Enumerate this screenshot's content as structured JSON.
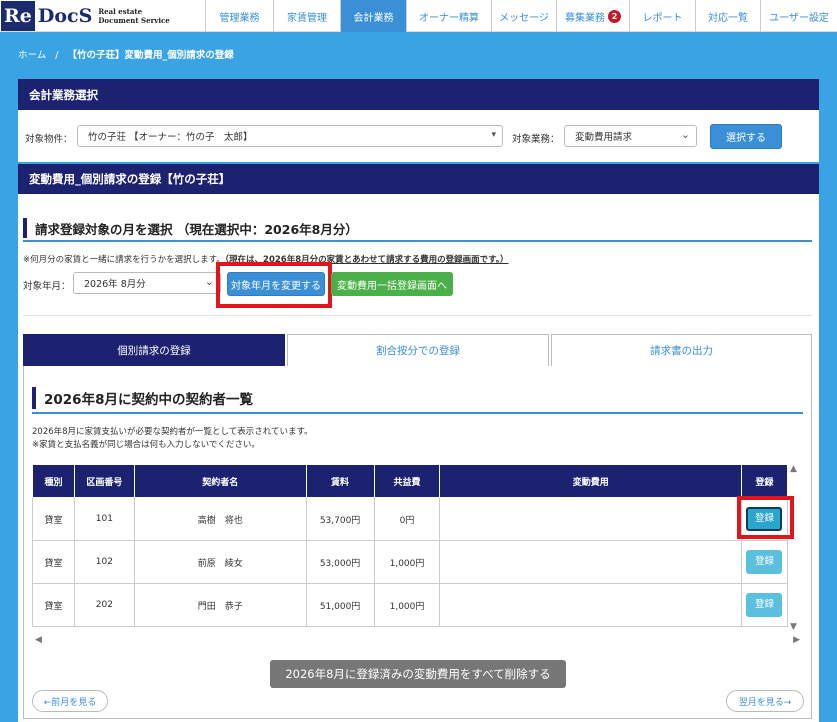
{
  "logo": {
    "mark": "Re",
    "name": "DocS",
    "tagline_1": "Real estate",
    "tagline_2": "Document Service"
  },
  "nav": [
    {
      "label": "管理業務"
    },
    {
      "label": "家賃管理"
    },
    {
      "label": "会計業務",
      "active": true
    },
    {
      "label": "オーナー精算"
    },
    {
      "label": "メッセージ"
    },
    {
      "label": "募集業務",
      "badge": "2"
    },
    {
      "label": "レポート"
    },
    {
      "label": "対応一覧"
    },
    {
      "label": "ユーザー設定"
    }
  ],
  "breadcrumb": {
    "home": "ホーム",
    "sep": "/",
    "current": "【竹の子荘】変動費用_個別請求の登録"
  },
  "accounting_select": {
    "header": "会計業務選択",
    "property_label": "対象物件：",
    "property_value": "竹の子荘 【オーナー：竹の子　太郎】",
    "task_label": "対象業務：",
    "task_value": "変動費用請求",
    "select_button": "選択する"
  },
  "variable_panel": {
    "header": "変動費用_個別請求の登録【竹の子荘】",
    "month_title": "請求登録対象の月を選択 （現在選択中：2026年8月分）",
    "note_prefix": "※何月分の家賃と一緒に請求を行うかを選択します。",
    "note_emphasis": "（現在は、2026年8月分の家賃とあわせて請求する費用の登録画面です。）",
    "month_label": "対象年月：",
    "month_value": "2026年 8月分",
    "change_month_button": "対象年月を変更する",
    "bulk_button": "変動費用一括登録画面へ"
  },
  "tabs": [
    {
      "label": "個別請求の登録",
      "active": true
    },
    {
      "label": "割合按分での登録"
    },
    {
      "label": "請求書の出力"
    }
  ],
  "contract_list": {
    "title": "2026年8月に契約中の契約者一覧",
    "note_1": "2026年8月に家賃支払いが必要な契約者が一覧として表示されています。",
    "note_2": "※家賃と支払名義が同じ場合は何も入力しないでください。",
    "columns": [
      "種別",
      "区画番号",
      "契約者名",
      "賃料",
      "共益費",
      "変動費用",
      "登録"
    ],
    "rows": [
      {
        "type": "貸室",
        "unit": "101",
        "name": "高樹　将也",
        "rent": "53,700円",
        "fee": "0円",
        "variable": "",
        "action": "登録"
      },
      {
        "type": "貸室",
        "unit": "102",
        "name": "前原　綾女",
        "rent": "53,000円",
        "fee": "1,000円",
        "variable": "",
        "action": "登録"
      },
      {
        "type": "貸室",
        "unit": "202",
        "name": "門田　恭子",
        "rent": "51,000円",
        "fee": "1,000円",
        "variable": "",
        "action": "登録"
      }
    ],
    "delete_all_button": "2026年8月に登録済みの変動費用をすべて削除する",
    "prev_month": "←前月を見る",
    "next_month": "翌月を見る→"
  },
  "colors": {
    "navy": "#1c2170",
    "accent": "#3a8fd6",
    "highlight": "#e4141b",
    "green": "#4cb04a"
  }
}
